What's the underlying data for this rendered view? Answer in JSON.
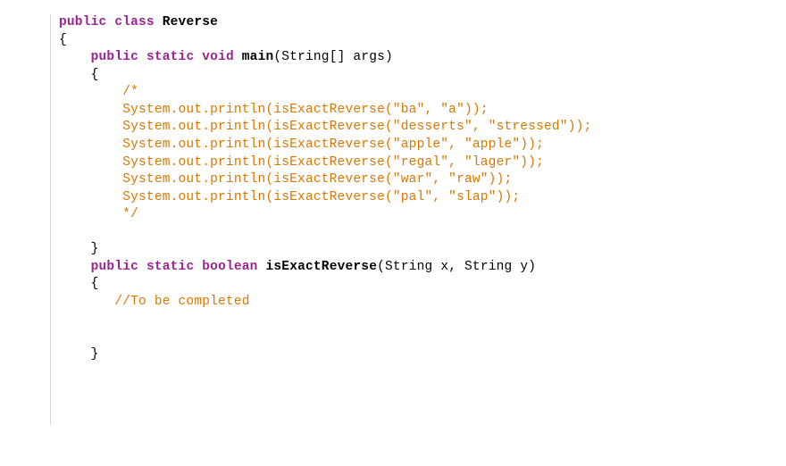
{
  "code": {
    "kw_public": "public",
    "kw_class": "class",
    "class_name": "Reverse",
    "brace_open": "{",
    "brace_close": "}",
    "kw_static": "static",
    "kw_void": "void",
    "fn_main": "main",
    "main_params": "(String[] args)",
    "comment_open": "/*",
    "calls": {
      "c1": "System.out.println(isExactReverse(\"ba\", \"a\"));",
      "c2": "System.out.println(isExactReverse(\"desserts\", \"stressed\"));",
      "c3": "System.out.println(isExactReverse(\"apple\", \"apple\"));",
      "c4": "System.out.println(isExactReverse(\"regal\", \"lager\"));",
      "c5": "System.out.println(isExactReverse(\"war\", \"raw\"));",
      "c6": "System.out.println(isExactReverse(\"pal\", \"slap\"));"
    },
    "comment_close": "*/",
    "kw_boolean": "boolean",
    "fn_isrev": "isExactReverse",
    "isrev_params": "(String x, String y)",
    "todo_comment": "//To be completed"
  }
}
